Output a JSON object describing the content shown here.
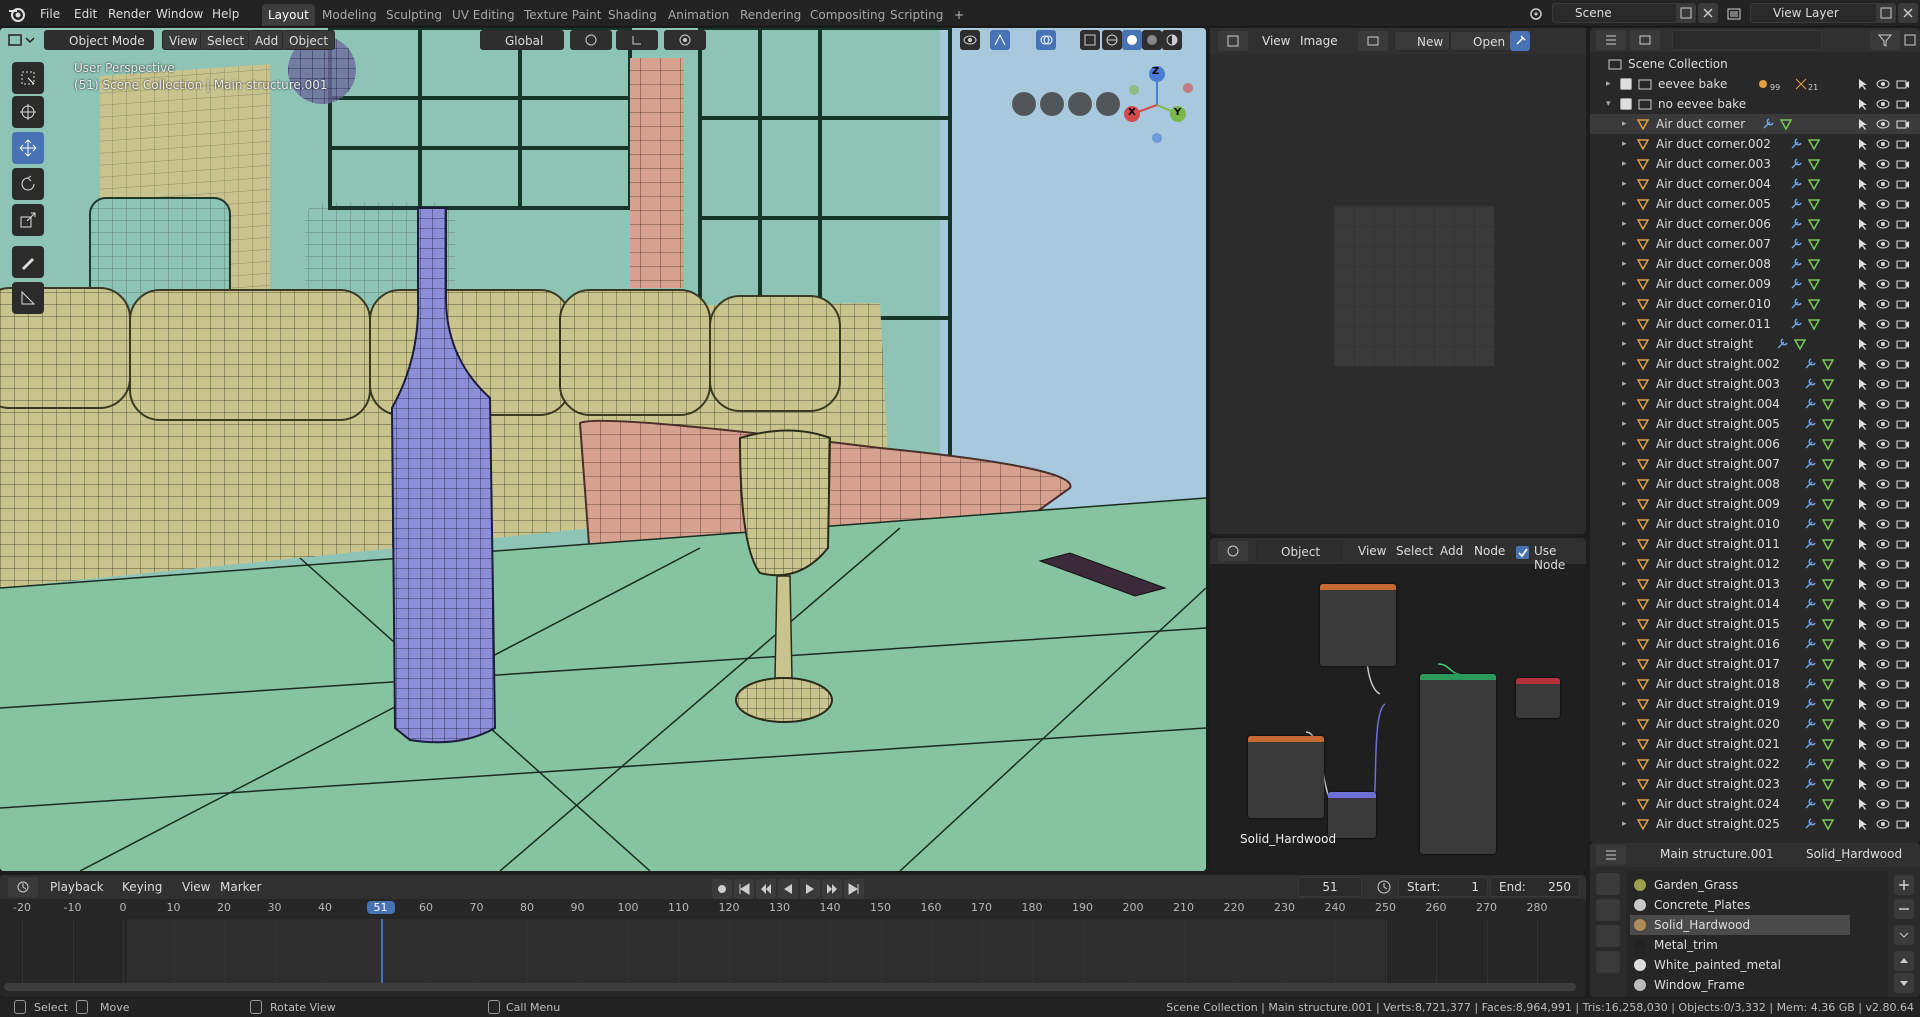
{
  "menu": {
    "items": [
      "File",
      "Edit",
      "Render",
      "Window",
      "Help"
    ]
  },
  "workspaces": {
    "tabs": [
      "Layout",
      "Modeling",
      "Sculpting",
      "UV Editing",
      "Texture Paint",
      "Shading",
      "Animation",
      "Rendering",
      "Compositing",
      "Scripting"
    ],
    "active": "Layout"
  },
  "scene": {
    "name": "Scene",
    "view_layer": "View Layer"
  },
  "viewport": {
    "mode": "Object Mode",
    "menus": [
      "View",
      "Select",
      "Add",
      "Object"
    ],
    "orientation": "Global",
    "perspective_label": "User Perspective",
    "collection_label": "(51) Scene Collection | Main structure.001",
    "gizmo": {
      "x": "X",
      "y": "Y",
      "z": "Z"
    }
  },
  "image_editor": {
    "menus": [
      "View",
      "Image"
    ],
    "new_label": "New",
    "open_label": "Open"
  },
  "node_editor": {
    "type": "Object",
    "menus": [
      "View",
      "Select",
      "Add",
      "Node"
    ],
    "use_nodes_label": "Use Node",
    "material_label": "Solid_Hardwood"
  },
  "outliner": {
    "root": "Scene Collection",
    "rows": [
      {
        "label": "eevee bake",
        "kind": "collection"
      },
      {
        "label": "no eevee bake",
        "kind": "collection"
      },
      {
        "label": "Air duct corner",
        "kind": "object"
      },
      {
        "label": "Air duct corner.002",
        "kind": "object"
      },
      {
        "label": "Air duct corner.003",
        "kind": "object"
      },
      {
        "label": "Air duct corner.004",
        "kind": "object"
      },
      {
        "label": "Air duct corner.005",
        "kind": "object"
      },
      {
        "label": "Air duct corner.006",
        "kind": "object"
      },
      {
        "label": "Air duct corner.007",
        "kind": "object"
      },
      {
        "label": "Air duct corner.008",
        "kind": "object"
      },
      {
        "label": "Air duct corner.009",
        "kind": "object"
      },
      {
        "label": "Air duct corner.010",
        "kind": "object"
      },
      {
        "label": "Air duct corner.011",
        "kind": "object"
      },
      {
        "label": "Air duct straight",
        "kind": "object"
      },
      {
        "label": "Air duct straight.002",
        "kind": "object"
      },
      {
        "label": "Air duct straight.003",
        "kind": "object"
      },
      {
        "label": "Air duct straight.004",
        "kind": "object"
      },
      {
        "label": "Air duct straight.005",
        "kind": "object"
      },
      {
        "label": "Air duct straight.006",
        "kind": "object"
      },
      {
        "label": "Air duct straight.007",
        "kind": "object"
      },
      {
        "label": "Air duct straight.008",
        "kind": "object"
      },
      {
        "label": "Air duct straight.009",
        "kind": "object"
      },
      {
        "label": "Air duct straight.010",
        "kind": "object"
      },
      {
        "label": "Air duct straight.011",
        "kind": "object"
      },
      {
        "label": "Air duct straight.012",
        "kind": "object"
      },
      {
        "label": "Air duct straight.013",
        "kind": "object"
      },
      {
        "label": "Air duct straight.014",
        "kind": "object"
      },
      {
        "label": "Air duct straight.015",
        "kind": "object"
      },
      {
        "label": "Air duct straight.016",
        "kind": "object"
      },
      {
        "label": "Air duct straight.017",
        "kind": "object"
      },
      {
        "label": "Air duct straight.018",
        "kind": "object"
      },
      {
        "label": "Air duct straight.019",
        "kind": "object"
      },
      {
        "label": "Air duct straight.020",
        "kind": "object"
      },
      {
        "label": "Air duct straight.021",
        "kind": "object"
      },
      {
        "label": "Air duct straight.022",
        "kind": "object"
      },
      {
        "label": "Air duct straight.023",
        "kind": "object"
      },
      {
        "label": "Air duct straight.024",
        "kind": "object"
      },
      {
        "label": "Air duct straight.025",
        "kind": "object"
      }
    ],
    "eevee_bake_counts": [
      "99",
      "21"
    ]
  },
  "properties": {
    "object": "Main structure.001",
    "material": "Solid_Hardwood",
    "slots": [
      "Garden_Grass",
      "Concrete_Plates",
      "Solid_Hardwood",
      "Metal_trim",
      "White_painted_metal",
      "Window_Frame"
    ],
    "selected_slot": "Solid_Hardwood"
  },
  "timeline": {
    "menus": [
      "Playback",
      "Keying",
      "View",
      "Marker"
    ],
    "current_frame": "51",
    "start_label": "Start:",
    "start": "1",
    "end_label": "End:",
    "end": "250",
    "ticks": [
      "-20",
      "-10",
      "0",
      "10",
      "20",
      "30",
      "40",
      "51",
      "60",
      "70",
      "80",
      "90",
      "100",
      "110",
      "120",
      "130",
      "140",
      "150",
      "160",
      "170",
      "180",
      "190",
      "200",
      "210",
      "220",
      "230",
      "240",
      "250",
      "260",
      "270",
      "280"
    ]
  },
  "statusbar": {
    "select": "Select",
    "move": "Move",
    "rotate": "Rotate View",
    "menu": "Call Menu",
    "stats": "Scene Collection | Main structure.001 | Verts:8,721,377 | Faces:8,964,991 | Tris:16,258,030 | Objects:0/3,332 | Mem: 4.36 GB | v2.80.64"
  },
  "colors": {
    "accent": "#4772b3",
    "viewport_bg": "#8ec4b5",
    "sofa": "#c9c48e",
    "bottle": "#8c8fd8",
    "ottoman": "#d7a18f",
    "floor": "#86c4a1",
    "frame_marker": "#4772b3"
  }
}
